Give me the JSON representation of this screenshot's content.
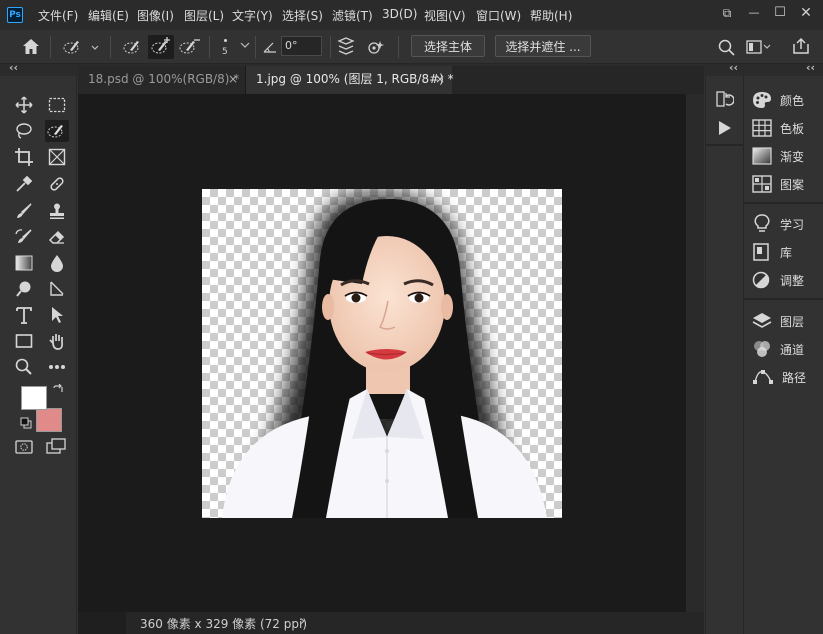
{
  "app": {
    "logo_text": "Ps"
  },
  "menu": [
    "文件(F)",
    "编辑(E)",
    "图像(I)",
    "图层(L)",
    "文字(Y)",
    "选择(S)",
    "滤镜(T)",
    "3D(D)",
    "视图(V)",
    "窗口(W)",
    "帮助(H)"
  ],
  "window_controls": {
    "restore": "⧉",
    "minimize": "—",
    "maximize": "☐",
    "close": "✕"
  },
  "options": {
    "brush_size": "5",
    "angle_value": "0°",
    "select_subject": "选择主体",
    "select_and_mask": "选择并遮住 ..."
  },
  "collapse": {
    "left": "‹‹",
    "right": "‹‹"
  },
  "tabs": [
    {
      "label": "18.psd @ 100%(RGB/8) *",
      "close": "×"
    },
    {
      "label": "1.jpg @ 100% (图层 1, RGB/8#) *",
      "close": "×"
    }
  ],
  "status": {
    "doc_size": "360 像素 x 329 像素 (72 ppi)",
    "arrow": "›"
  },
  "panels": {
    "group1": [
      "颜色",
      "色板",
      "渐变",
      "图案"
    ],
    "group2": [
      "学习",
      "库",
      "调整"
    ],
    "group3": [
      "图层",
      "通道",
      "路径"
    ]
  },
  "colors": {
    "foreground": "#ffffff",
    "background": "#e08a8a",
    "accent": "#31a8ff"
  }
}
